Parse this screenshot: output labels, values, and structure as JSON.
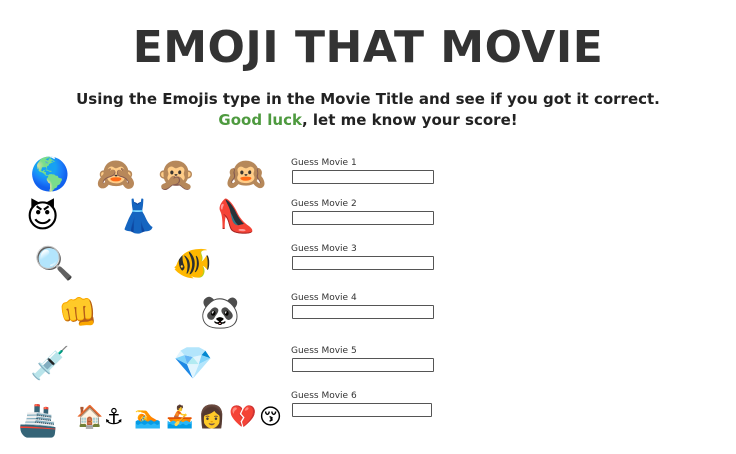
{
  "header": {
    "title": "EMOJI THAT MOVIE",
    "line1": "Using the Emojis type in the Movie Title and see if you got it correct.",
    "line2_highlight": "Good luck",
    "line2_rest": ", let me know your score!"
  },
  "colors": {
    "highlight": "#4e9a3f",
    "title": "#333333"
  },
  "rows": [
    {
      "emojis": [
        "🌎",
        "🙈",
        "🙊",
        "🙉"
      ],
      "label": "Guess Movie 1",
      "value": ""
    },
    {
      "emojis": [
        "😈",
        "👗",
        "👠"
      ],
      "label": "Guess Movie 2",
      "value": ""
    },
    {
      "emojis": [
        "🔍",
        "🐠"
      ],
      "label": "Guess Movie 3",
      "value": ""
    },
    {
      "emojis": [
        "👊",
        "🐼"
      ],
      "label": "Guess Movie 4",
      "value": ""
    },
    {
      "emojis": [
        "💉",
        "💎"
      ],
      "label": "Guess Movie 5",
      "value": ""
    },
    {
      "emojis": [
        "🚢",
        "🏠",
        "⚓",
        "🏊",
        "🚣",
        "👩",
        "💔",
        "😚"
      ],
      "label": "Guess Movie 6",
      "value": ""
    }
  ]
}
